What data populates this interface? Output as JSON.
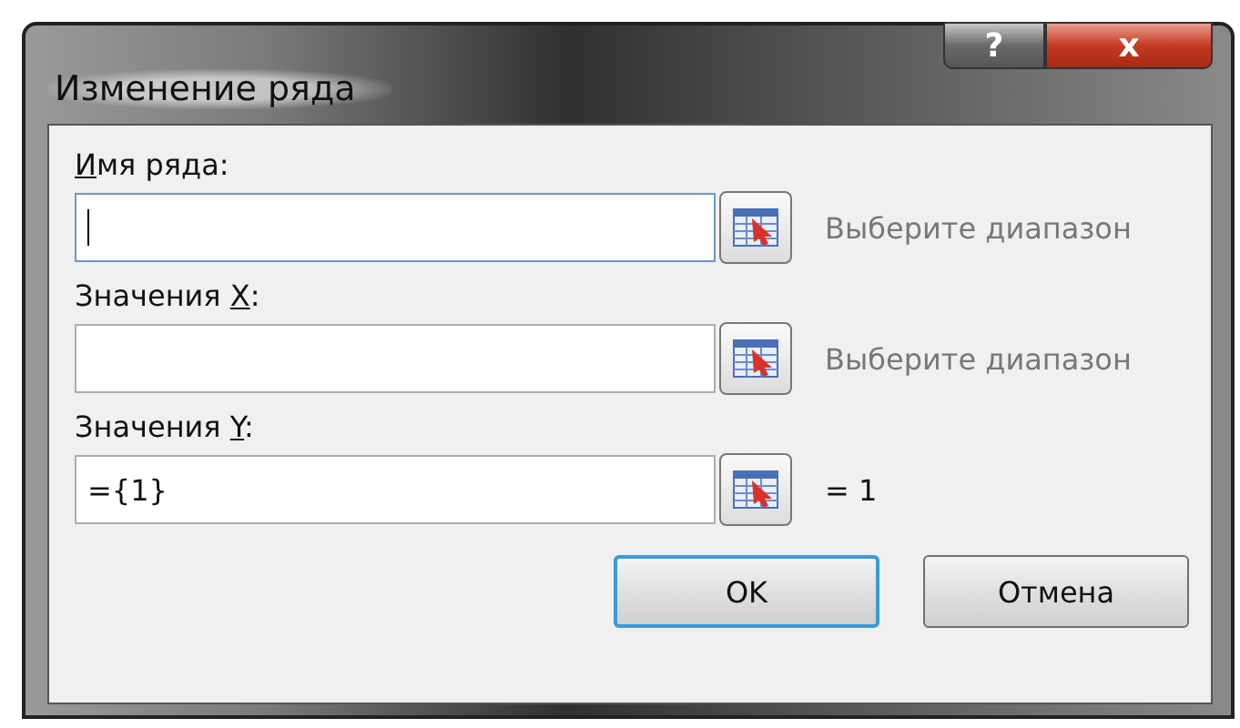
{
  "window": {
    "title": "Изменение ряда",
    "controls": [
      {
        "kind": "help",
        "label": "?"
      },
      {
        "kind": "close",
        "label": "x"
      }
    ]
  },
  "fields": [
    {
      "label_parts": [
        {
          "text": "И",
          "underline": true
        },
        {
          "text": "мя ряда:",
          "underline": false
        }
      ],
      "focused": true,
      "hint": "Выберите диапазон"
    },
    {
      "label_parts": [
        {
          "text": "Значения ",
          "underline": false
        },
        {
          "text": "X",
          "underline": true
        },
        {
          "text": ":",
          "underline": false
        }
      ],
      "focused": false,
      "hint": "Выберите диапазон"
    },
    {
      "label_parts": [
        {
          "text": "Значения ",
          "underline": false
        },
        {
          "text": "Y",
          "underline": true
        },
        {
          "text": ":",
          "underline": false
        }
      ],
      "value": "={1}",
      "focused": false,
      "hint": "= 1"
    }
  ],
  "buttons": [
    {
      "label": "OK",
      "default": true
    },
    {
      "label": "Отмена",
      "default": false
    }
  ]
}
